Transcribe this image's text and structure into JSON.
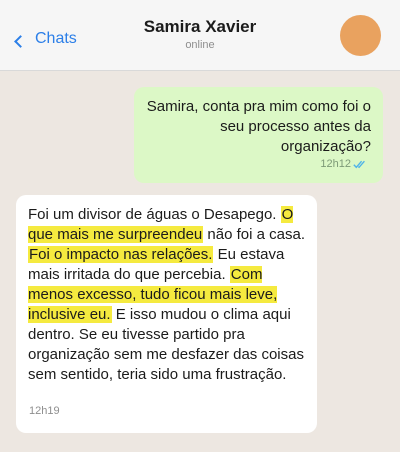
{
  "header": {
    "back_label": "Chats",
    "contact_name": "Samira Xavier",
    "status": "online",
    "avatar_color": "#e9a25f"
  },
  "messages": {
    "outgoing": {
      "text": "Samira, conta pra mim como foi o seu processo antes da organização?",
      "time": "12h12",
      "read_receipt_color": "#4fb3e8",
      "bubble_color": "#dcf8c6"
    },
    "incoming": {
      "parts": [
        "Foi um divisor de águas o Desapego. ",
        "O que mais me surpreendeu",
        " não foi a casa. ",
        "Foi o impacto nas relações.",
        " Eu estava mais irritada do que percebia. ",
        "Com menos excesso, tudo ficou mais leve, inclusive eu.",
        " E isso mudou o clima aqui dentro. Se eu tivesse partido pra organização sem me desfazer das coisas sem sentido, teria sido uma frustração."
      ],
      "time": "12h19",
      "highlight_color": "#f5ea3f",
      "bubble_color": "#ffffff"
    }
  }
}
